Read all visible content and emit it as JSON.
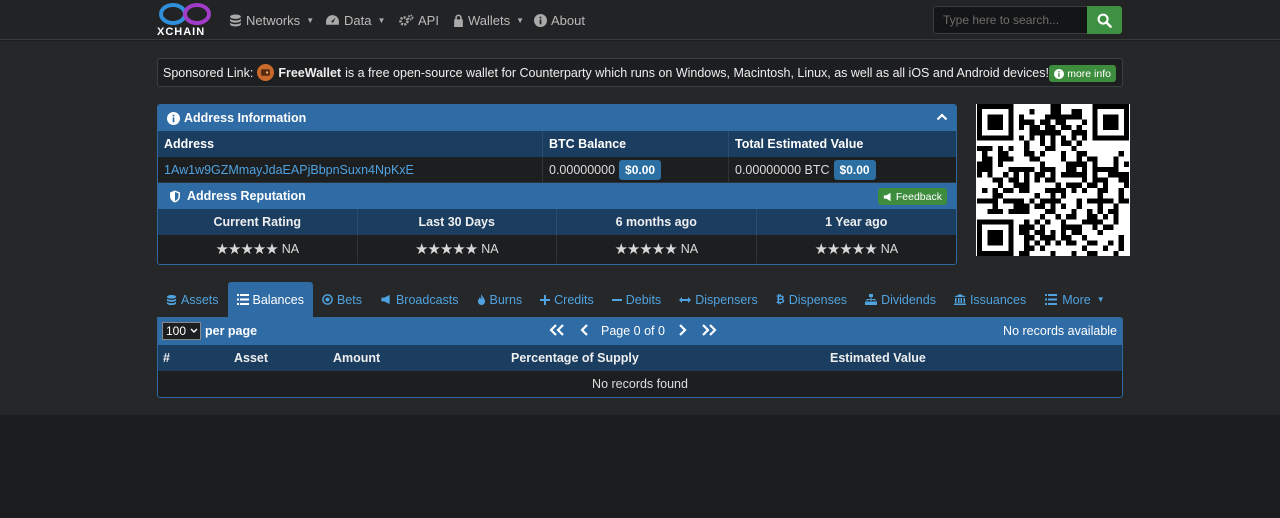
{
  "navbar": {
    "brand": "XCHAIN",
    "items": [
      {
        "label": "Networks",
        "dropdown": true,
        "icon": "database-icon"
      },
      {
        "label": "Data",
        "dropdown": true,
        "icon": "dashboard-icon"
      },
      {
        "label": "API",
        "dropdown": false,
        "icon": "cogs-icon"
      },
      {
        "label": "Wallets",
        "dropdown": true,
        "icon": "lock-icon"
      },
      {
        "label": "About",
        "dropdown": false,
        "icon": "info-icon"
      }
    ],
    "search_placeholder": "Type here to search..."
  },
  "sponsor": {
    "prefix": "Sponsored Link:",
    "name": "FreeWallet",
    "text": "is a free open-source wallet for Counterparty which runs on Windows, Macintosh, Linux, as well as all iOS and Android devices!",
    "button": "more info"
  },
  "address_info": {
    "title": "Address Information",
    "headers": [
      "Address",
      "BTC Balance",
      "Total Estimated Value"
    ],
    "address": "1Aw1w9GZMmayJdaEAPjBbpnSuxn4NpKxE",
    "btc_balance": "0.00000000",
    "btc_usd": "$0.00",
    "total_value": "0.00000000 BTC",
    "total_usd": "$0.00"
  },
  "reputation": {
    "title": "Address Reputation",
    "feedback": "Feedback",
    "columns": [
      "Current Rating",
      "Last 30 Days",
      "6 months ago",
      "1 Year ago"
    ],
    "value": "NA",
    "stars": "★★★★★"
  },
  "tabs": [
    {
      "label": "Assets",
      "icon": "database-icon",
      "active": false
    },
    {
      "label": "Balances",
      "icon": "list-icon",
      "active": true
    },
    {
      "label": "Bets",
      "icon": "target-icon",
      "active": false
    },
    {
      "label": "Broadcasts",
      "icon": "bullhorn-icon",
      "active": false
    },
    {
      "label": "Burns",
      "icon": "fire-icon",
      "active": false
    },
    {
      "label": "Credits",
      "icon": "plus-icon",
      "active": false
    },
    {
      "label": "Debits",
      "icon": "minus-icon",
      "active": false
    },
    {
      "label": "Dispensers",
      "icon": "arrows-h-icon",
      "active": false
    },
    {
      "label": "Dispenses",
      "icon": "bitcoin-icon",
      "active": false
    },
    {
      "label": "Dividends",
      "icon": "sitemap-icon",
      "active": false
    },
    {
      "label": "Issuances",
      "icon": "bank-icon",
      "active": false
    },
    {
      "label": "More",
      "icon": "list-icon",
      "active": false,
      "dropdown": true
    }
  ],
  "table": {
    "per_page": "100",
    "per_page_label": "per page",
    "page_label": "Page 0 of 0",
    "records_status": "No records available",
    "columns": [
      "#",
      "Asset",
      "Amount",
      "Percentage of Supply",
      "Estimated Value"
    ],
    "empty_text": "No records found"
  },
  "colors": {
    "accent_blue": "#2f6ba5",
    "link_blue": "#4fa3e0",
    "success_green": "#3e8d3f",
    "background": "#1c1d1f"
  }
}
